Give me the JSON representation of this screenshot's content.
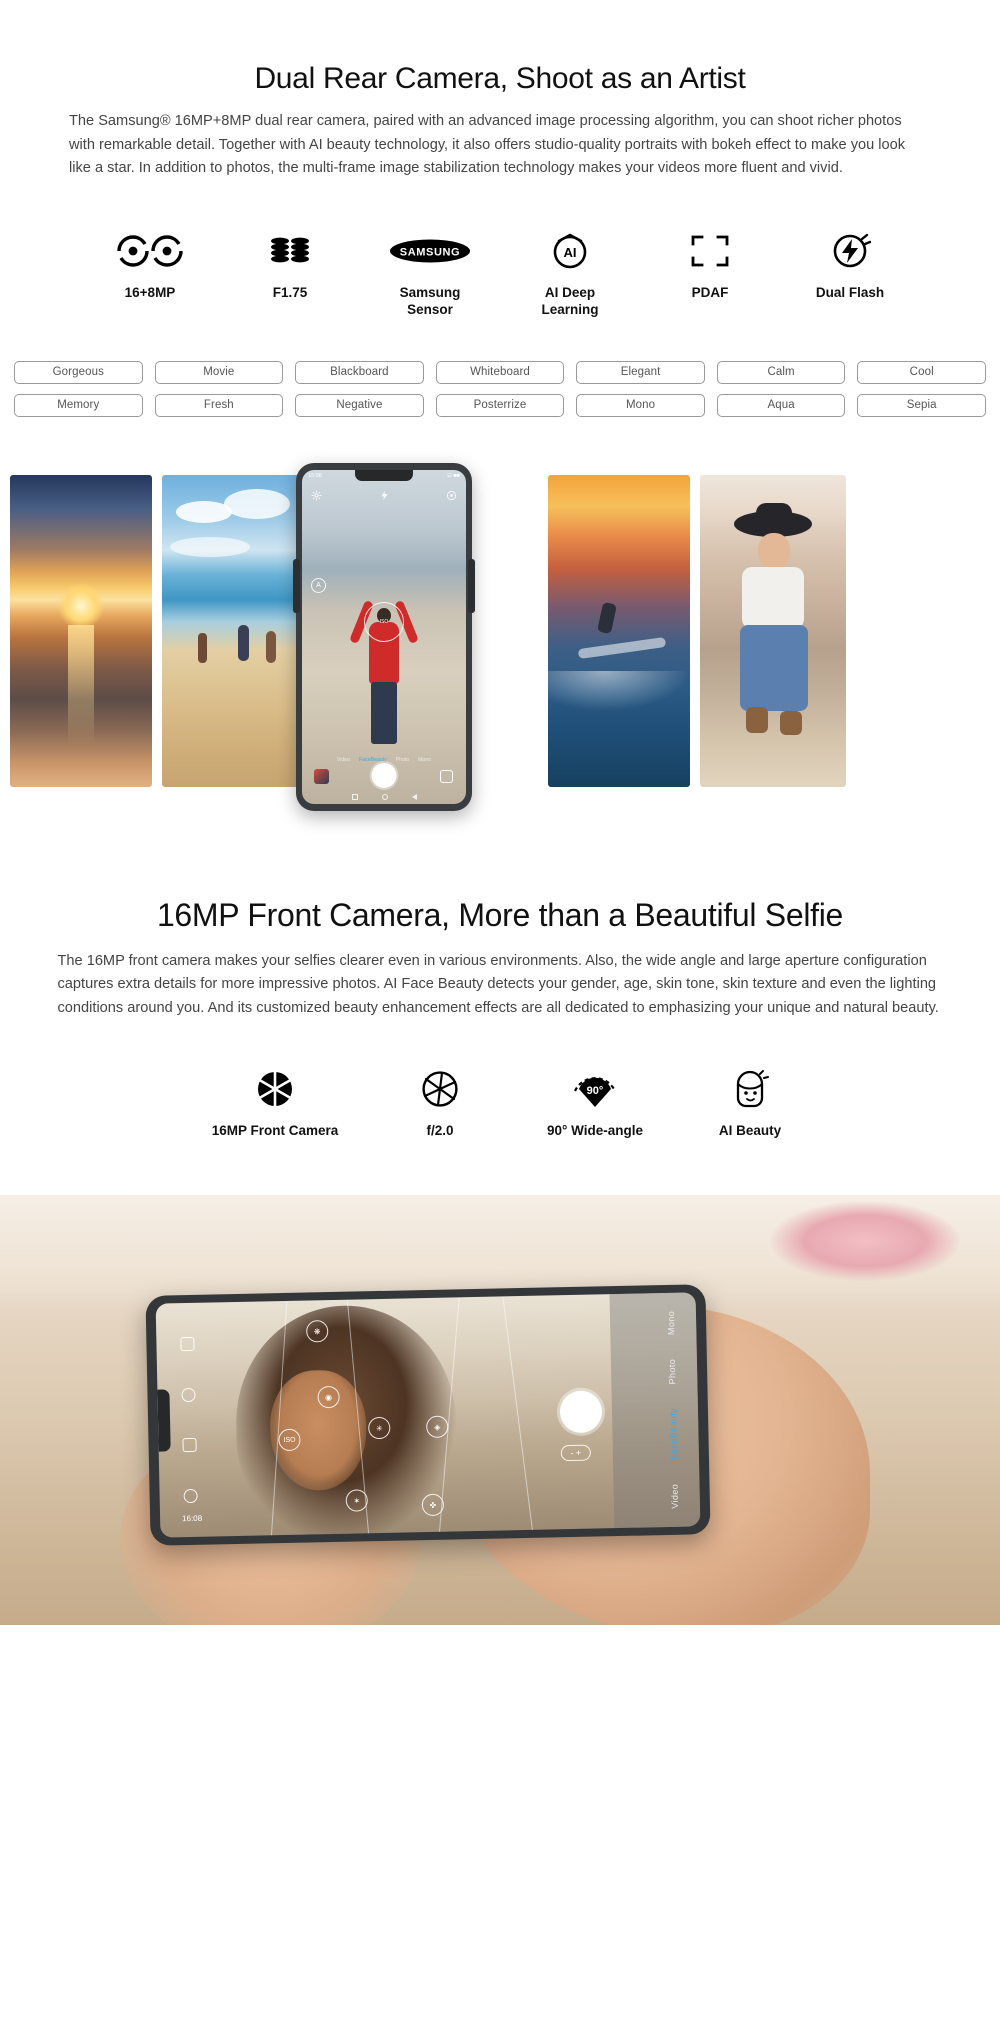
{
  "section1": {
    "heading": "Dual Rear Camera, Shoot as an Artist",
    "paragraph": "The Samsung® 16MP+8MP dual rear camera, paired with an advanced image processing algorithm, you can shoot richer photos with remarkable detail. Together  with AI beauty technology, it also offers studio-quality portraits with bokeh effect to make you look like a star. In addition to photos, the multi-frame image stabilization technology makes your videos more fluent and vivid.",
    "features": [
      {
        "icon": "dual-lens-icon",
        "label": "16+8MP"
      },
      {
        "icon": "aperture-stack-icon",
        "label": "F1.75"
      },
      {
        "icon": "samsung-logo-icon",
        "label": "Samsung\nSensor"
      },
      {
        "icon": "ai-circle-icon",
        "label": "AI Deep\nLearning"
      },
      {
        "icon": "focus-brackets-icon",
        "label": "PDAF"
      },
      {
        "icon": "dual-flash-icon",
        "label": "Dual Flash"
      }
    ],
    "filters": [
      "Gorgeous",
      "Movie",
      "Blackboard",
      "Whiteboard",
      "Elegant",
      "Calm",
      "Cool",
      "Memory",
      "Fresh",
      "Negative",
      "Posterrize",
      "Mono",
      "Aqua",
      "Sepia"
    ]
  },
  "gallery": {
    "items": [
      {
        "name": "sunset-beach-photo"
      },
      {
        "name": "beach-people-photo"
      },
      {
        "name": "surfer-sunset-photo"
      },
      {
        "name": "woman-hat-portrait-photo"
      }
    ],
    "phone": {
      "status_time": "16:08",
      "status_icons": "☲ ■■",
      "iso_label": "ISO",
      "auto_badge": "A",
      "modes": [
        "Video",
        "FaceBeauty",
        "Photo",
        "Mono"
      ],
      "active_mode": "FaceBeauty"
    }
  },
  "section2": {
    "heading": "16MP Front Camera, More  than a Beautiful Selfie",
    "paragraph": "The 16MP front camera makes your selfies clearer even in various environments. Also, the wide angle and large aperture configuration captures extra details for more impressive photos. AI Face Beauty detects your gender, age, skin tone, skin texture and even the lighting conditions around you. And its customized beauty enhancement effects are all dedicated to emphasizing your unique and natural beauty.",
    "features": [
      {
        "icon": "aperture-solid-icon",
        "label": "16MP Front Camera"
      },
      {
        "icon": "aperture-outline-icon",
        "label": "f/2.0"
      },
      {
        "icon": "wide-angle-90-icon",
        "label": "90° Wide-angle",
        "badge": "90°"
      },
      {
        "icon": "ai-beauty-face-icon",
        "label": "AI Beauty"
      }
    ]
  },
  "hero": {
    "name": "hand-holding-phone-selfie-photo",
    "phone": {
      "status_time": "16:08",
      "modes": [
        "Video",
        "FaceBeauty",
        "Photo",
        "Mono"
      ],
      "active_mode": "FaceBeauty",
      "iso_label": "ISO",
      "zoom_controls": "- +"
    }
  },
  "colors": {
    "accent": "#39a7e8",
    "text": "#111111",
    "body_text": "#444444",
    "chip_border": "#999999"
  }
}
